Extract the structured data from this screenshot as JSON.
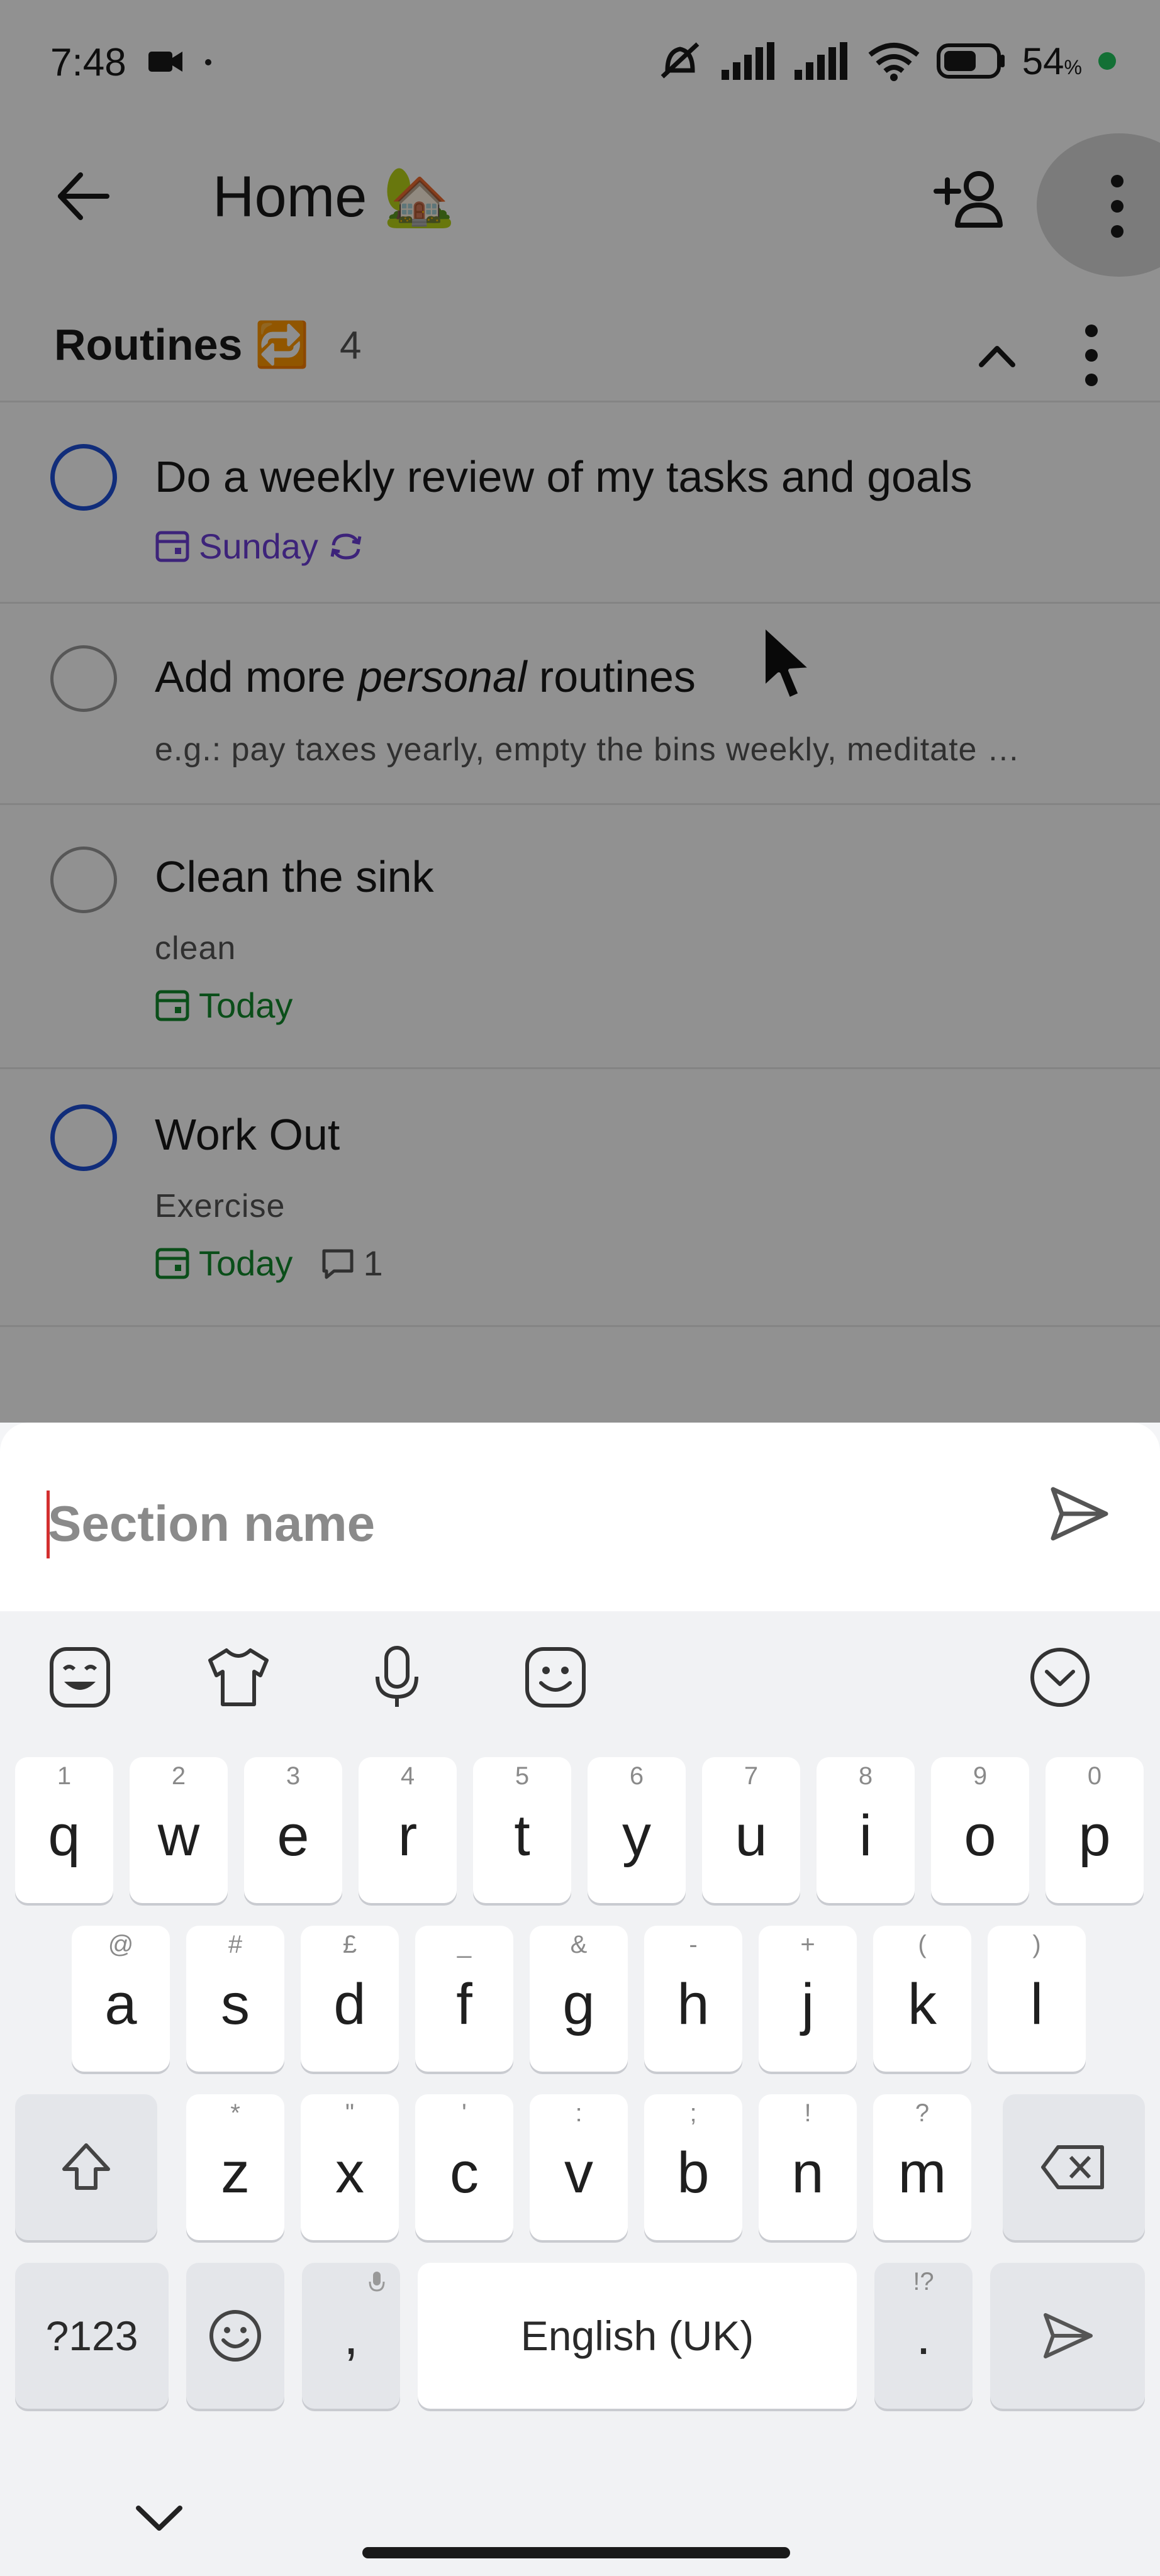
{
  "status": {
    "time": "7:48",
    "battery_percent": "54",
    "battery_unit": "%"
  },
  "header": {
    "title": "Home 🏡",
    "icons": [
      "back-arrow-icon",
      "add-person-icon",
      "more-vertical-icon"
    ]
  },
  "section": {
    "title": "Routines 🔁",
    "count": "4"
  },
  "tasks": [
    {
      "name": "Do a weekly review of my tasks and goals",
      "due": "Sunday",
      "recurring": true,
      "priority_color": "#1e4fd6"
    },
    {
      "name_before": "Add more ",
      "name_italic": "personal",
      "name_after": " routines",
      "description": "e.g.: pay taxes yearly, empty the bins weekly, meditate …"
    },
    {
      "name": "Clean the sink",
      "description": "clean",
      "due": "Today"
    },
    {
      "name": "Work Out",
      "description": "Exercise",
      "due": "Today",
      "comments": "1",
      "priority_color": "#1e4fd6"
    }
  ],
  "sheet": {
    "input_placeholder": "Section name",
    "input_value": ""
  },
  "keyboard": {
    "toolbar_icons": [
      "sticker-icon",
      "theme-shirt-icon",
      "microphone-icon",
      "emoji-face-icon",
      "collapse-keyboard-icon"
    ],
    "row1": [
      {
        "key": "q",
        "sup": "1"
      },
      {
        "key": "w",
        "sup": "2"
      },
      {
        "key": "e",
        "sup": "3"
      },
      {
        "key": "r",
        "sup": "4"
      },
      {
        "key": "t",
        "sup": "5"
      },
      {
        "key": "y",
        "sup": "6"
      },
      {
        "key": "u",
        "sup": "7"
      },
      {
        "key": "i",
        "sup": "8"
      },
      {
        "key": "o",
        "sup": "9"
      },
      {
        "key": "p",
        "sup": "0"
      }
    ],
    "row2": [
      {
        "key": "a",
        "sup": "@"
      },
      {
        "key": "s",
        "sup": "#"
      },
      {
        "key": "d",
        "sup": "£"
      },
      {
        "key": "f",
        "sup": "_"
      },
      {
        "key": "g",
        "sup": "&"
      },
      {
        "key": "h",
        "sup": "-"
      },
      {
        "key": "j",
        "sup": "+"
      },
      {
        "key": "k",
        "sup": "("
      },
      {
        "key": "l",
        "sup": ")"
      }
    ],
    "row3": [
      {
        "key": "z",
        "sup": "*"
      },
      {
        "key": "x",
        "sup": "\""
      },
      {
        "key": "c",
        "sup": "'"
      },
      {
        "key": "v",
        "sup": ":"
      },
      {
        "key": "b",
        "sup": ";"
      },
      {
        "key": "n",
        "sup": "!"
      },
      {
        "key": "m",
        "sup": "?"
      }
    ],
    "symbols_label": "?123",
    "comma_label": ",",
    "space_label": "English (UK)",
    "period_label": ".",
    "period_sup": "!?"
  }
}
